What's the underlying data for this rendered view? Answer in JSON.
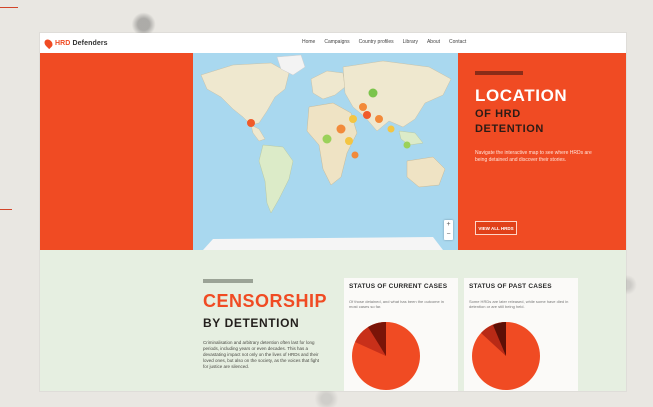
{
  "site": {
    "logo_hrd": "HRD",
    "logo_rest": " Defenders",
    "nav": [
      "Home",
      "Campaigns",
      "Country profiles",
      "Library",
      "About",
      "Contact"
    ]
  },
  "hero": {
    "title": "LOCATION",
    "subtitle": "OF HRD\nDETENTION",
    "description": "Navigate the interactive map to see where HRDs are being detained and discover their stories.",
    "button": "VIEW ALL HRDS",
    "accent_color": "#f04b23"
  },
  "censorship": {
    "title": "CENSORSHIP",
    "subtitle": "BY DETENTION",
    "description": "Criminalisation and arbitrary detention often last for long periods, including years or even decades. This has a devastating impact not only on the lives of HRDs and their loved ones, but also on the society, as the voices that fight for justice are silenced."
  },
  "current_cases": {
    "title": "STATUS OF CURRENT CASES",
    "description": "Of those detained, and what has been the outcome in most cases so far.",
    "pie_colors": [
      "#f04b23",
      "#c8301a",
      "#7a1408"
    ]
  },
  "past_cases": {
    "title": "STATUS OF PAST CASES",
    "description": "Some HRDs are later released, while some have died in detention or are still being held.",
    "pie_colors": [
      "#f04b23",
      "#b82a16",
      "#5c0f06"
    ]
  }
}
